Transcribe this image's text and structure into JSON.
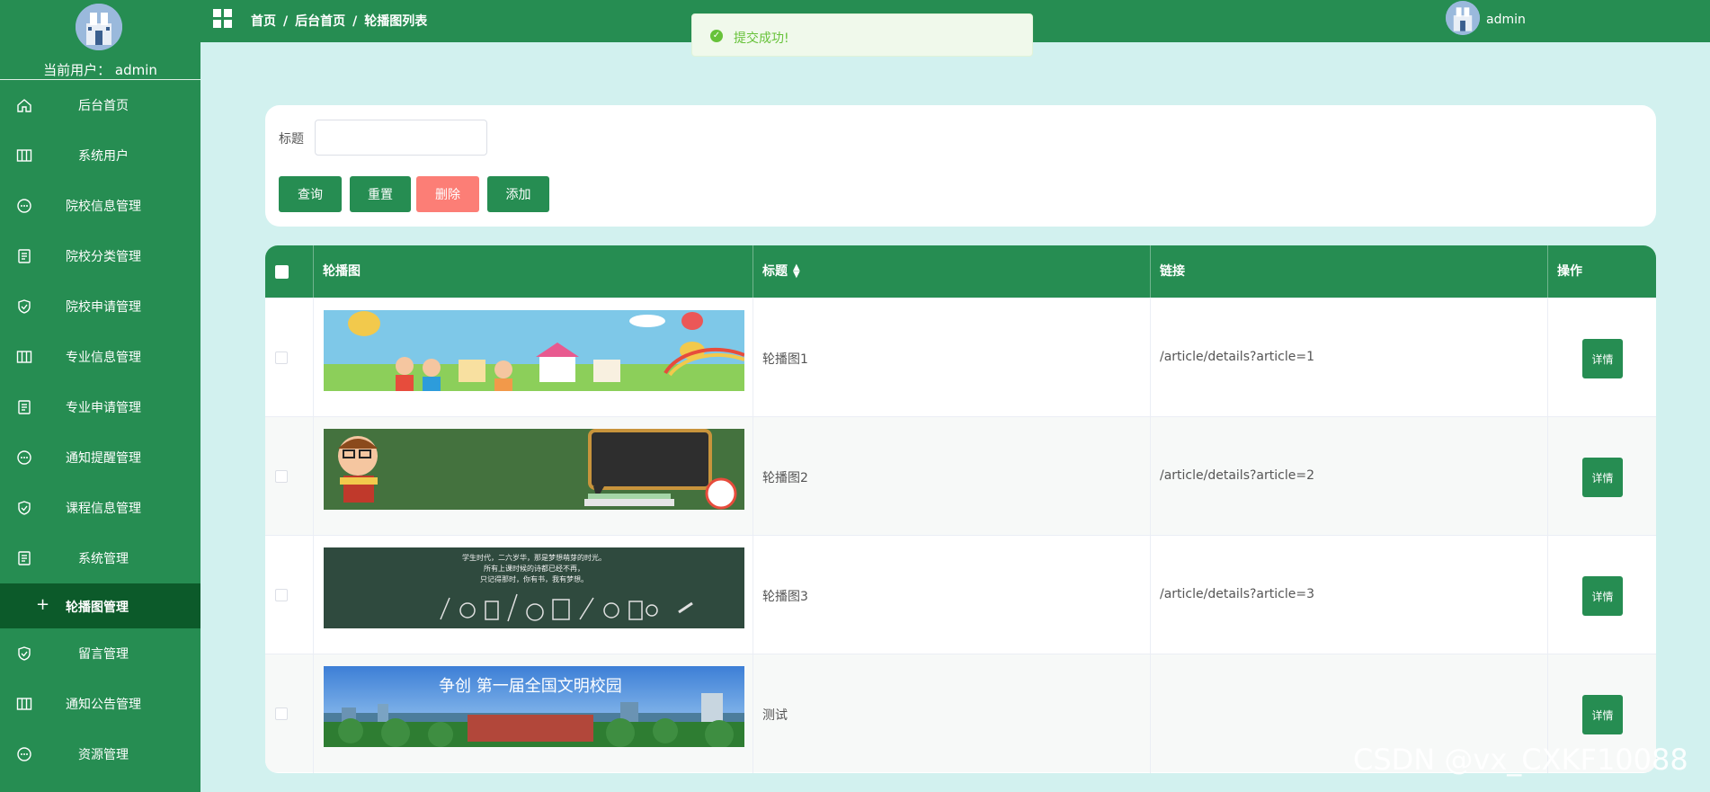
{
  "sidebar": {
    "current_user": "当前用户： admin",
    "items": [
      {
        "label": "后台首页",
        "icon": "home-icon"
      },
      {
        "label": "系统用户",
        "icon": "columns-icon"
      },
      {
        "label": "院校信息管理",
        "icon": "chat-icon"
      },
      {
        "label": "院校分类管理",
        "icon": "document-icon"
      },
      {
        "label": "院校申请管理",
        "icon": "shield-check-icon"
      },
      {
        "label": "专业信息管理",
        "icon": "columns-icon"
      },
      {
        "label": "专业申请管理",
        "icon": "document-icon"
      },
      {
        "label": "通知提醒管理",
        "icon": "chat-icon"
      },
      {
        "label": "课程信息管理",
        "icon": "shield-check-icon"
      },
      {
        "label": "系统管理",
        "icon": "document-icon"
      }
    ],
    "active_item": {
      "label": "轮播图管理",
      "icon": "plus-icon"
    },
    "items_after": [
      {
        "label": "留言管理",
        "icon": "shield-check-icon"
      },
      {
        "label": "通知公告管理",
        "icon": "columns-icon"
      },
      {
        "label": "资源管理",
        "icon": "chat-icon"
      }
    ]
  },
  "topbar": {
    "breadcrumb": [
      "首页",
      "后台首页",
      "轮播图列表"
    ],
    "breadcrumb_sep": "/",
    "user": "admin"
  },
  "toast": {
    "message": "提交成功!"
  },
  "search": {
    "title_label": "标题",
    "buttons": {
      "query": "查询",
      "reset": "重置",
      "delete": "删除",
      "add": "添加"
    }
  },
  "table": {
    "headers": {
      "image": "轮播图",
      "title": "标题",
      "link": "链接",
      "actions": "操作"
    },
    "rows": [
      {
        "title": "轮播图1",
        "link": "/article/details?article=1",
        "action": "详情"
      },
      {
        "title": "轮播图2",
        "link": "/article/details?article=2",
        "action": "详情"
      },
      {
        "title": "轮播图3",
        "link": "/article/details?article=3",
        "action": "详情"
      },
      {
        "title": "测试",
        "link": "",
        "action": "详情"
      }
    ],
    "banner3_text": [
      "学生时代，二六岁华，那是梦想萌芽的时光。",
      "所有上课时候的诗都已经不再，",
      "只记得那时，你有书，我有梦想。"
    ],
    "banner4_text": "争创 第一届全国文明校园"
  },
  "watermark": "CSDN @vx_CXKF10088",
  "colors": {
    "primary": "#268d52",
    "active": "#0c5a2a",
    "danger": "#fc7e76",
    "background": "#d2f1ef",
    "success": "#67c23a"
  }
}
